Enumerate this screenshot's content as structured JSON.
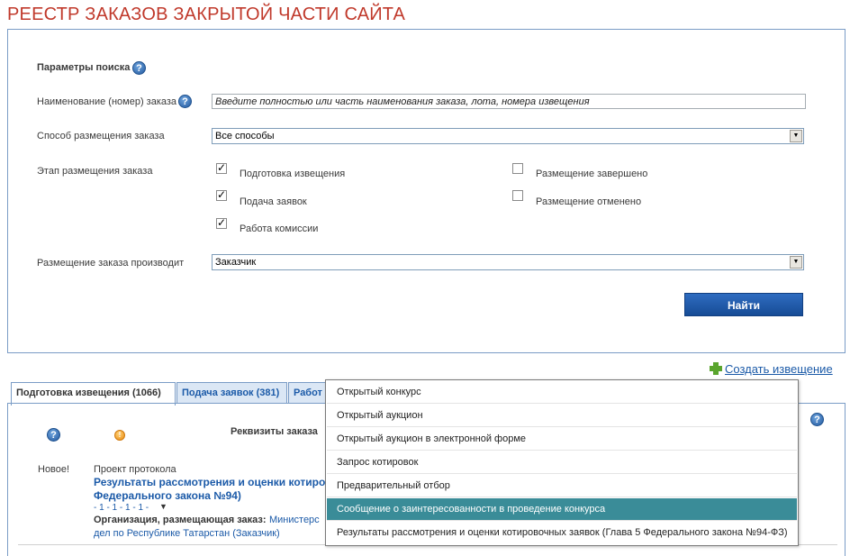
{
  "page": {
    "title": "РЕЕСТР ЗАКАЗОВ ЗАКРЫТОЙ ЧАСТИ САЙТА"
  },
  "search": {
    "heading": "Параметры поиска",
    "name_label": "Наименование (номер) заказа",
    "name_placeholder": "Введите полностью или часть наименования заказа, лота, номера извещения",
    "method_label": "Способ размещения заказа",
    "method_value": "Все способы",
    "stage_label": "Этап размещения заказа",
    "stages": [
      {
        "label": "Подготовка извещения",
        "checked": true
      },
      {
        "label": "Подача заявок",
        "checked": true
      },
      {
        "label": "Работа комиссии",
        "checked": true
      },
      {
        "label": "Размещение завершено",
        "checked": false
      },
      {
        "label": "Размещение отменено",
        "checked": false
      }
    ],
    "placer_label": "Размещение заказа производит",
    "placer_value": "Заказчик",
    "find_button": "Найти"
  },
  "create_link": "Создать извещение",
  "tabs": [
    {
      "label": "Подготовка извещения (1066)",
      "active": true
    },
    {
      "label": "Подача заявок (381)",
      "active": false
    },
    {
      "label": "Работ",
      "active": false
    }
  ],
  "results": {
    "column_header": "Реквизиты заказа",
    "row": {
      "status": "Новое!",
      "type": "Проект протокола",
      "title_line1": "Результаты рассмотрения и оценки котиров",
      "title_line2": "Федерального закона №94)",
      "pager": "- 1 - 1 - 1 - 1 -",
      "org_label": "Организация, размещающая заказ:",
      "org_value_line1": "Министерс",
      "org_value_line2": "дел по Республике Татарстан (Заказчик)"
    }
  },
  "dropdown": {
    "items": [
      "Открытый конкурс",
      "Открытый аукцион",
      "Открытый аукцион в электронной форме",
      "Запрос котировок",
      "Предварительный отбор",
      "Сообщение о заинтересованности в проведение конкурса",
      "Результаты рассмотрения и оценки котировочных заявок (Глава 5 Федерального закона №94-ФЗ)"
    ],
    "selected_index": 5
  },
  "colors": {
    "title": "#c0392b",
    "accent": "#1b5aa8",
    "selected": "#3a8c98"
  }
}
